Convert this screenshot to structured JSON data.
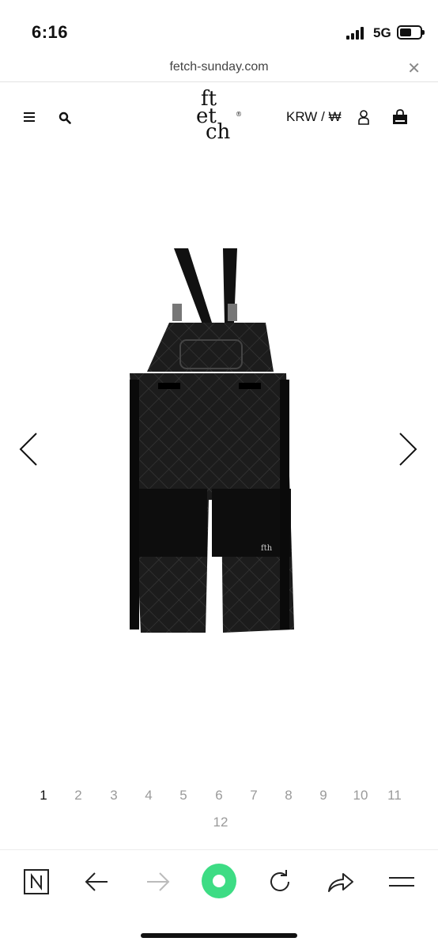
{
  "status_bar": {
    "time": "6:16",
    "network": "5G"
  },
  "url_bar": {
    "domain": "fetch-sunday.com"
  },
  "header": {
    "logo": {
      "line1": "ft",
      "line2": "et",
      "line3": "ch",
      "mark": "®"
    },
    "currency": "KRW / ₩"
  },
  "product": {
    "image_icon": "quilted-overalls-photo"
  },
  "pagination": {
    "current": 1,
    "pages": [
      "1",
      "2",
      "3",
      "4",
      "5",
      "6",
      "7",
      "8",
      "9",
      "10",
      "11",
      "12"
    ]
  },
  "toolbar": {
    "icons": [
      "naver-home-icon",
      "back-icon",
      "forward-icon",
      "green-dot-icon",
      "reload-icon",
      "share-icon",
      "menu-icon"
    ]
  },
  "colors": {
    "accent_green": "#3ddc84",
    "text_dark": "#111111",
    "text_muted": "#9a9a9a"
  }
}
